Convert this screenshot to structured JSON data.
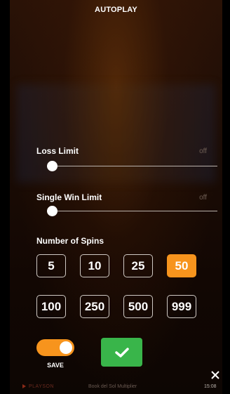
{
  "header": {
    "title": "AUTOPLAY"
  },
  "loss_limit": {
    "label": "Loss Limit",
    "value": "off",
    "fraction": 0
  },
  "single_win_limit": {
    "label": "Single Win Limit",
    "value": "off",
    "fraction": 0
  },
  "spins": {
    "label": "Number of Spins",
    "options": [
      "5",
      "10",
      "25",
      "50",
      "100",
      "250",
      "500",
      "999"
    ],
    "selected": "50",
    "accent_color": "#f7941d"
  },
  "save": {
    "label": "SAVE",
    "enabled": true
  },
  "confirm": {
    "icon": "checkmark-icon",
    "color": "#39b54a"
  },
  "close": {
    "icon": "close-icon"
  },
  "footer": {
    "brand": "PLAYSON",
    "game": "Book del Sol Multiplier",
    "time": "15:08"
  }
}
